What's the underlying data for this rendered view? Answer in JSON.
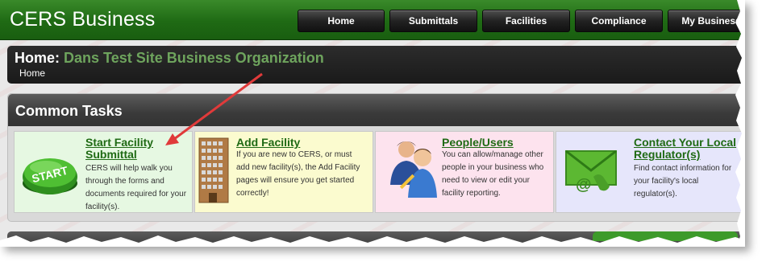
{
  "app": {
    "title": "CERS Business"
  },
  "nav": {
    "items": [
      {
        "label": "Home"
      },
      {
        "label": "Submittals"
      },
      {
        "label": "Facilities"
      },
      {
        "label": "Compliance"
      },
      {
        "label": "My Business"
      }
    ]
  },
  "breadcrumb": {
    "prefix": "Home:",
    "organization": "Dans Test Site Business Organization",
    "trail": "Home"
  },
  "common_tasks": {
    "title": "Common Tasks",
    "cards": [
      {
        "title": "Start Facility Submittal",
        "description": "CERS will help walk you through the forms and documents required for your facility(s).",
        "icon": "start-button-icon",
        "icon_text": "START"
      },
      {
        "title": "Add Facility",
        "description": "If you are new to CERS, or must add new facility(s), the Add Facility pages will ensure you get started correctly!",
        "icon": "building-icon"
      },
      {
        "title": "People/Users",
        "description": "You can allow/manage other people in your business who need to view or edit your facility reporting.",
        "icon": "users-icon"
      },
      {
        "title": "Contact Your Local Regulator(s)",
        "description": "Find contact information for your facility's local regulator(s).",
        "icon": "email-phone-icon"
      }
    ]
  },
  "colors": {
    "brand_green": "#1f6a14",
    "org_green": "#6ea45d",
    "annotation_red": "#e03a3a"
  }
}
